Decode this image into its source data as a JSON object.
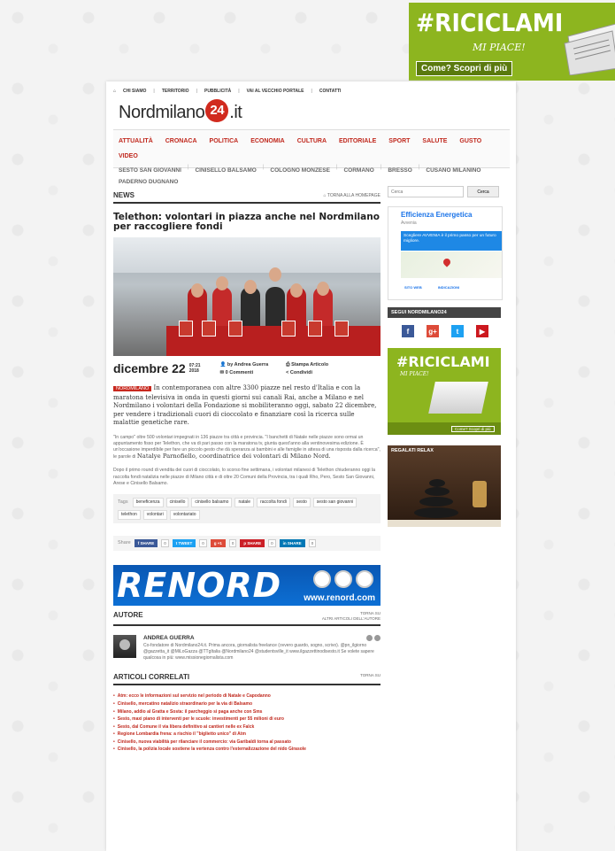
{
  "top_banner": {
    "hashtag": "#RICICLAMI",
    "sub": "MI PIACE!",
    "cta": "Come? Scopri di più"
  },
  "topnav": [
    "CHI SIAMO",
    "TERRITORIO",
    "PUBBLICITÀ",
    "VAI AL VECCHIO PORTALE",
    "CONTATTI"
  ],
  "logo": {
    "pre": "Nordmilano",
    "num": "24",
    "post": ".it"
  },
  "mainmenu": [
    "ATTUALITÀ",
    "CRONACA",
    "POLITICA",
    "ECONOMIA",
    "CULTURA",
    "EDITORIALE",
    "SPORT",
    "SALUTE",
    "GUSTO",
    "VIDEO"
  ],
  "submenu": [
    "SESTO SAN GIOVANNI",
    "CINISELLO BALSAMO",
    "COLOGNO MONZESE",
    "CORMANO",
    "BRESSO",
    "CUSANO MILANINO",
    "PADERNO DUGNANO"
  ],
  "section": {
    "label": "NEWS",
    "back": "TORNA ALLA HOMEPAGE"
  },
  "article": {
    "headline": "Telethon: volontari in piazza anche nel Nordmilano per raccogliere fondi",
    "date": "dicembre 22",
    "time": "07:21",
    "year": "2018",
    "byline": "by Andrea Guerra",
    "comments": "0 Commenti",
    "print": "Stampa Articolo",
    "share": "Condividi",
    "category": "NORDMILANO",
    "lead": "In contemporanea con altre 3300 piazze nel resto d'Italia e con la maratona televisiva in onda in questi giorni sui canali Rai, anche a Milano e nel Nordmilano i volontari della Fondazione si mobiliteranno oggi, sabato 22 dicembre, per vendere i tradizionali cuori di cioccolato e finanziare così la ricerca sulle malattie genetiche rare.",
    "body1": "\"In campo\" oltre 500 volontari impegnati in 136 piazze tra città e provincia. \"I banchetti di Natale nelle piazze sono ormai un appuntamento fisso per Telethon, che va di pari passo con la maratona tv, giunta quest'anno alla ventinovesima edizione. È un'occasione imperdibile per fare un piccolo gesto che dà speranza ai bambini e alle famiglie in attesa di una risposta dalla ricerca\", le parole di",
    "body1_name": "Natalye Parnofiello, coordinatrice dei volontari di Milano Nord.",
    "body2": "Dopo il primo round di vendita dei cuori di cioccolato, lo scorso fine settimana, i volontari milanesi di Telethon chiuderanno oggi la raccolta fondi natalizia nelle piazze di Milano città e di oltre 20 Comuni della Provincia, tra i quali Rho, Pero, Sesto San Giovanni, Arese e Cinisello Balsamo."
  },
  "tags": {
    "label": "Tags",
    "items": [
      "beneficenza",
      "cinisello",
      "cinisello balsamo",
      "natale",
      "raccolta fondi",
      "sesto",
      "sesto san giovanni",
      "telethon",
      "volontari",
      "volontariato"
    ]
  },
  "share": {
    "label": "Share",
    "buttons": [
      {
        "name": "SHARE",
        "count": "0",
        "color": "#3b5998"
      },
      {
        "name": "TWEET",
        "count": "0",
        "color": "#1da1f2"
      },
      {
        "name": "+1",
        "count": "0",
        "color": "#dd4b39"
      },
      {
        "name": "SHARE",
        "count": "0",
        "color": "#cb2027"
      },
      {
        "name": "SHARE",
        "count": "0",
        "color": "#0077b5"
      }
    ]
  },
  "renord": {
    "word": "RENORD",
    "url": "www.renord.com"
  },
  "author": {
    "label": "AUTORE",
    "link1": "TORNA SU",
    "link2": "ALTRI ARTICOLI DELL'AUTORE",
    "name": "ANDREA GUERRA",
    "bio": "Co-fondatore di Nordmilano24.it. Prima ancora, giornalista freelance (ovvero guardo, sogno, scrivo). @pn_ilgiorno @gazzetta_it @MiLoGazza @TTgItalia @Nordmilano24 @studentsville_it www.ilgazzettinodisesto.it Se volete sapere qualcosa in più: www.missionegiornalista.com"
  },
  "related": {
    "label": "ARTICOLI CORRELATI",
    "back": "TORNA SU",
    "items": [
      "Atm: ecco le informazioni sul servizio nel periodo di Natale e Capodanno",
      "Cinisello, mercatino natalizio straordinario per la via di Balsamo",
      "Milano, addio al Gratta e Sosta: il parcheggio si paga anche con Sms",
      "Sesto, maxi piano di interventi per le scuole: investimenti per 55 milioni di euro",
      "Sesto, dal Comune il via libera definitivo ai cantieri nelle ex Falck",
      "Regione Lombardia frena: a rischio il \"biglietto unico\" di Atm",
      "Cinisello, nuova viabilità per rilanciare il commercio: via Garibaldi torna al passato",
      "Cinisello, la polizia locale sostiene la vertenza contro l'esternalizzazione del nido Girasole"
    ]
  },
  "sidebar": {
    "search_placeholder": "Cerca",
    "search_button": "Cerca",
    "efficienza": {
      "title": "Efficienza Energetica",
      "advertiser": "Avvenia",
      "band": "Scegliere AVVENIA è il primo passo per un futuro migliore.",
      "btn1": "SITO WEB",
      "btn2": "INDICAZIONI"
    },
    "follow": "SEGUI NORDMILANO24",
    "social": [
      {
        "glyph": "f",
        "color": "#3b5998"
      },
      {
        "glyph": "g+",
        "color": "#dd4b39"
      },
      {
        "glyph": "t",
        "color": "#1da1f2"
      },
      {
        "glyph": "▶",
        "color": "#cc181e"
      }
    ],
    "ricicla": {
      "hashtag": "#RICICLAMI",
      "sub": "MI PIACE!",
      "cta": "Come? Scopri di più"
    },
    "relax": {
      "title": "REGALATI RELAX"
    }
  }
}
